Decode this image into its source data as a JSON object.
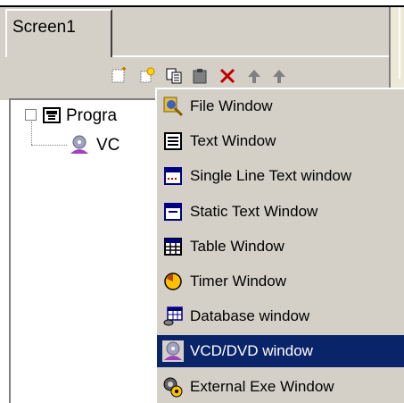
{
  "window": {
    "tabs": [
      {
        "label": "Screen1",
        "active": true
      }
    ]
  },
  "toolbar": {
    "icons": [
      "new-icon",
      "new-star-icon",
      "copy-icon",
      "paste-icon",
      "delete-icon",
      "move-up-icon",
      "move-down-icon"
    ]
  },
  "tree": {
    "root": {
      "expander": "⊟",
      "label": "Progra",
      "icon": "program-icon"
    },
    "child": {
      "label": "VC",
      "icon": "vcd-icon"
    }
  },
  "context_menu": {
    "items": [
      {
        "label": "File Window",
        "icon": "file-window-icon",
        "selected": false
      },
      {
        "label": "Text Window",
        "icon": "text-window-icon",
        "selected": false
      },
      {
        "label": "Single Line Text window",
        "icon": "single-line-text-icon",
        "selected": false
      },
      {
        "label": "Static Text Window",
        "icon": "static-text-icon",
        "selected": false
      },
      {
        "label": "Table Window",
        "icon": "table-window-icon",
        "selected": false
      },
      {
        "label": "Timer Window",
        "icon": "timer-window-icon",
        "selected": false
      },
      {
        "label": "Database window",
        "icon": "database-window-icon",
        "selected": false
      },
      {
        "label": "VCD/DVD window",
        "icon": "vcd-dvd-icon",
        "selected": true
      },
      {
        "label": "External Exe Window",
        "icon": "external-exe-icon",
        "selected": false
      }
    ]
  },
  "colors": {
    "face": "#d4d0c8",
    "highlight": "#0a246a",
    "highlight_text": "#ffffff"
  }
}
